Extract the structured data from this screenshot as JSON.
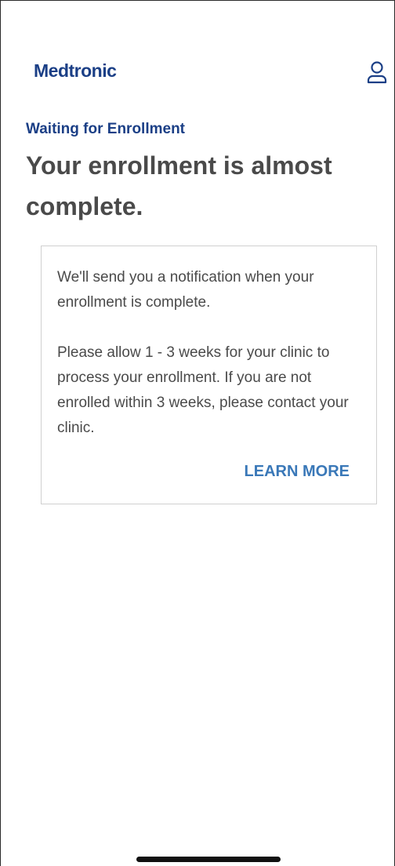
{
  "header": {
    "logo_text": "Medtronic",
    "profile_icon": "user-profile-icon"
  },
  "page": {
    "eyebrow": "Waiting for Enrollment",
    "title": "Your enrollment is almost complete."
  },
  "card": {
    "paragraph_1": "We'll send you a notification when your enrollment is complete.",
    "paragraph_2": "Please allow 1 - 3 weeks for your clinic to process your enrollment. If you are not enrolled within 3 weeks, please contact your clinic.",
    "learn_more_label": "LEARN MORE"
  },
  "colors": {
    "brand_navy": "#1b3f86",
    "link_blue": "#3a78b8",
    "text_gray": "#4a4a4a",
    "card_border": "#d0d0d0"
  }
}
